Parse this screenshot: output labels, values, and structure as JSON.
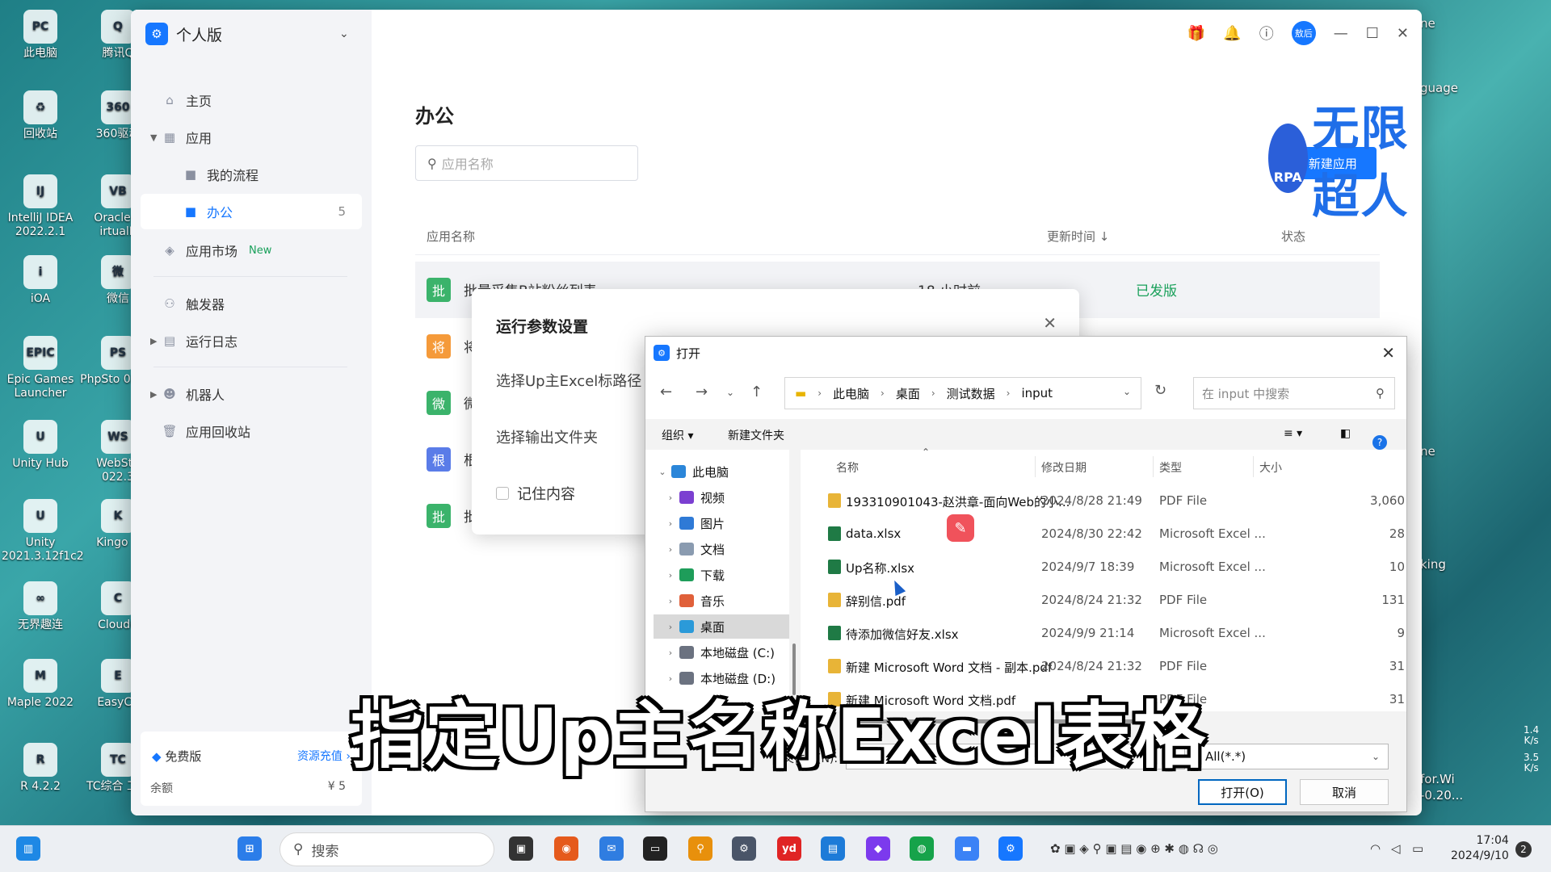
{
  "desktop": {
    "left_icons": [
      {
        "label": "此电脑",
        "glyph": "PC"
      },
      {
        "label": "回收站",
        "glyph": "♻"
      },
      {
        "label": "IntelliJ IDEA 2022.2.1",
        "glyph": "IJ"
      },
      {
        "label": "iOA",
        "glyph": "i"
      },
      {
        "label": "Epic Games Launcher",
        "glyph": "EPIC"
      },
      {
        "label": "Unity Hub",
        "glyph": "U"
      },
      {
        "label": "Unity 2021.3.12f1c2",
        "glyph": "U"
      },
      {
        "label": "无界趣连",
        "glyph": "∞"
      },
      {
        "label": "Maple 2022",
        "glyph": "M"
      },
      {
        "label": "R 4.2.2",
        "glyph": "R"
      }
    ],
    "second_icons": [
      {
        "label": "腾讯Q",
        "glyph": "Q"
      },
      {
        "label": "360驱动",
        "glyph": "360"
      },
      {
        "label": "Oracle V irtualE",
        "glyph": "VB"
      },
      {
        "label": "微信",
        "glyph": "微"
      },
      {
        "label": "PhpSto 022.3",
        "glyph": "PS"
      },
      {
        "label": "WebSto 022.3",
        "glyph": "WS"
      },
      {
        "label": "Kingo R",
        "glyph": "K"
      },
      {
        "label": "CloudC",
        "glyph": "C"
      },
      {
        "label": "EasyCo",
        "glyph": "E"
      },
      {
        "label": "TC综合 工具",
        "glyph": "TC"
      }
    ],
    "right_fragments": [
      "ne",
      "guage",
      "ne",
      "king",
      "for.Wi",
      "-0.20..."
    ]
  },
  "app": {
    "edition": "个人版",
    "sidebar": {
      "home": "主页",
      "apps": "应用",
      "my_flows": "我的流程",
      "office": "办公",
      "office_count": "5",
      "market": "应用市场",
      "market_badge": "New",
      "triggers": "触发器",
      "run_logs": "运行日志",
      "robots": "机器人",
      "recycle": "应用回收站"
    },
    "plan": {
      "name": "免费版",
      "recharge": "资源充值 ›",
      "balance_label": "余额",
      "balance_value": "¥ 5"
    },
    "avatar_text": "敖后",
    "page_title": "办公",
    "search_placeholder": "应用名称",
    "new_app_label": "＋ 新建应用",
    "watermark": {
      "robot": "RPA",
      "text": "无限超人"
    },
    "table": {
      "headers": {
        "name": "应用名称",
        "updated": "更新时间 ↓",
        "status": "状态"
      },
      "rows": [
        {
          "icon": "批",
          "color": "#3bb36b",
          "name": "批量采集B站粉丝列表",
          "updated": "18 小时前",
          "status": "已发版"
        },
        {
          "icon": "将",
          "color": "#f59a3a",
          "name": "将",
          "updated": "",
          "status": ""
        },
        {
          "icon": "微",
          "color": "#3bb36b",
          "name": "微",
          "updated": "",
          "status": ""
        },
        {
          "icon": "根",
          "color": "#5a7ce8",
          "name": "根",
          "updated": "",
          "status": ""
        },
        {
          "icon": "批",
          "color": "#3bb36b",
          "name": "批",
          "updated": "",
          "status": ""
        }
      ]
    }
  },
  "params_dialog": {
    "title": "运行参数设置",
    "field1": "选择Up主Excel标路径",
    "field2": "选择输出文件夹",
    "remember": "记住内容"
  },
  "file_dialog": {
    "title": "打开",
    "breadcrumb": [
      "此电脑",
      "桌面",
      "测试数据",
      "input"
    ],
    "search_placeholder": "在 input 中搜索",
    "organize": "组织 ▾",
    "new_folder": "新建文件夹",
    "tree": [
      {
        "label": "此电脑",
        "color": "#2b86d9",
        "expanded": true
      },
      {
        "label": "视频",
        "color": "#7b3fd1"
      },
      {
        "label": "图片",
        "color": "#2f7ad6"
      },
      {
        "label": "文档",
        "color": "#8a9bb0"
      },
      {
        "label": "下载",
        "color": "#1e9d5a"
      },
      {
        "label": "音乐",
        "color": "#e0603a"
      },
      {
        "label": "桌面",
        "color": "#2b9ad9",
        "selected": true
      },
      {
        "label": "本地磁盘 (C:)",
        "color": "#6b7280"
      },
      {
        "label": "本地磁盘 (D:)",
        "color": "#6b7280"
      }
    ],
    "columns": {
      "name": "名称",
      "date": "修改日期",
      "type": "类型",
      "size": "大小"
    },
    "files": [
      {
        "name": "193310901043-赵洪章-面向Web的小...",
        "date": "2024/8/28 21:49",
        "type": "PDF File",
        "size": "3,060",
        "kind": "pdf"
      },
      {
        "name": "data.xlsx",
        "date": "2024/8/30 22:42",
        "type": "Microsoft Excel ...",
        "size": "28",
        "kind": "xlsx"
      },
      {
        "name": "Up名称.xlsx",
        "date": "2024/9/7 18:39",
        "type": "Microsoft Excel ...",
        "size": "10",
        "kind": "xlsx"
      },
      {
        "name": "辞别信.pdf",
        "date": "2024/8/24 21:32",
        "type": "PDF File",
        "size": "131",
        "kind": "pdf"
      },
      {
        "name": "待添加微信好友.xlsx",
        "date": "2024/9/9 21:14",
        "type": "Microsoft Excel ...",
        "size": "9",
        "kind": "xlsx"
      },
      {
        "name": "新建 Microsoft Word 文档 - 副本.pdf",
        "date": "2024/8/24 21:32",
        "type": "PDF File",
        "size": "31",
        "kind": "pdf"
      },
      {
        "name": "新建 Microsoft Word 文档.pdf",
        "date": "",
        "type": "PDF File",
        "size": "31",
        "kind": "pdf"
      }
    ],
    "filename_label": "文件名(N):",
    "filetype": "All(*.*)",
    "open_button": "打开(O)",
    "cancel_button": "取消"
  },
  "subtitle": "指定Up主名称Excel表格",
  "taskbar": {
    "search": "搜索",
    "time": "17:04",
    "date": "2024/9/10",
    "notifications": "2",
    "net_up": "1.4",
    "net_down": "3.5",
    "net_unit": "K/s"
  },
  "colors": {
    "accent": "#1677ff",
    "success": "#19a05a"
  }
}
